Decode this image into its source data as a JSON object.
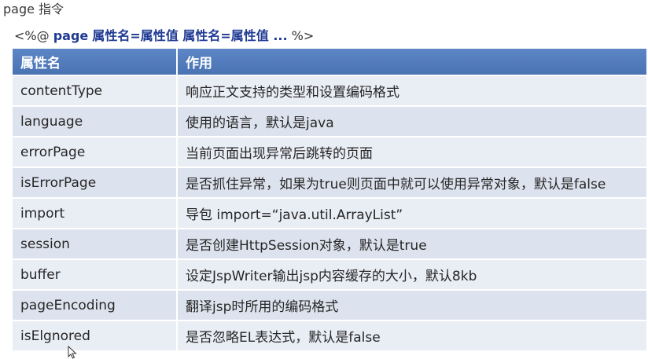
{
  "page": {
    "title": "page 指令",
    "syntax": {
      "open": "<%@",
      "keyword": "page",
      "attrs": "属性名=属性值 属性名=属性值 ...",
      "close": "%>"
    }
  },
  "table": {
    "headers": [
      "属性名",
      "作用"
    ],
    "rows": [
      {
        "name": "contentType",
        "desc": "响应正文支持的类型和设置编码格式"
      },
      {
        "name": "language",
        "desc": "使用的语言，默认是java"
      },
      {
        "name": "errorPage",
        "desc": "当前页面出现异常后跳转的页面"
      },
      {
        "name": "isErrorPage",
        "desc": "是否抓住异常，如果为true则页面中就可以使用异常对象，默认是false"
      },
      {
        "name": "import",
        "desc": "导包 import=“java.util.ArrayList”"
      },
      {
        "name": "session",
        "desc": "是否创建HttpSession对象，默认是true"
      },
      {
        "name": "buffer",
        "desc": "设定JspWriter输出jsp内容缓存的大小，默认8kb"
      },
      {
        "name": "pageEncoding",
        "desc": "翻译jsp时所用的编码格式"
      },
      {
        "name": "isElgnored",
        "desc": "是否忽略EL表达式，默认是false"
      }
    ]
  }
}
